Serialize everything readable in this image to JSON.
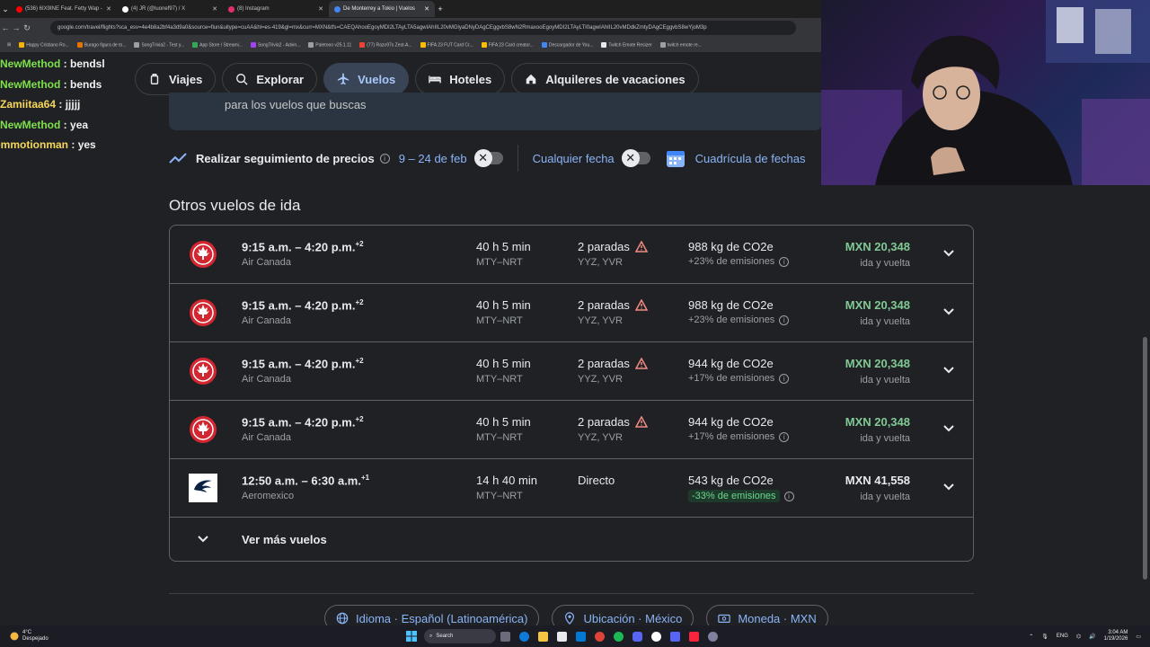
{
  "browser": {
    "tabs": [
      {
        "label": "(536) 6IX9INE Feat. Fetty Wap -",
        "color": "#ff0000"
      },
      {
        "label": "(4) JR (@luonef97) / X",
        "color": "#ffffff"
      },
      {
        "label": "(8) Instagram",
        "color": "#e1306c"
      },
      {
        "label": "De Monterrey a Tokio | Vuelos",
        "color": "#4285f4"
      }
    ],
    "url": "google.com/travel/flights?sca_esv=4e4b8a2bf4a3d9a0&source=flun&uitype=cuAA&hl=es-419&gl=mx&curr=MXN&tfs=CAEQAhooEgoyMDI2LTAyLTA5agwIAhIIL20vMGlyaDNyDAgCEggvbS8wN2RmaxooEgoyMDI2LTAyLTI0agwIAhIIL20vMDdkZmtyDAgCEggvbS8wYjoM3p",
    "bookmarks": [
      "Happy Cristiano Ro...",
      "Burago figura de to...",
      "SongTrivia2 - Test y...",
      "App Store / Streami...",
      "SongTrivia2 - Advin...",
      "Paletooo v25.1.11",
      "(77) Razo97s Zest-A...",
      "FIFA 23 FUT Card Cr...",
      "FIFA 23 Card creator...",
      "Descargador de You...",
      "Twitch Emote Resizer",
      "twitch emote re..."
    ]
  },
  "chat": [
    {
      "user": "NewMethod",
      "message": "bendsl",
      "color": "green"
    },
    {
      "user": "NewMethod",
      "message": "bends",
      "color": "green"
    },
    {
      "user": "Zamiitaa64",
      "message": "jjjjj",
      "color": "yellow"
    },
    {
      "user": "NewMethod",
      "message": "yea",
      "color": "green"
    },
    {
      "user": "emmotionman",
      "message": "yes",
      "color": "yellow"
    }
  ],
  "nav": {
    "viajes": "Viajes",
    "explorar": "Explorar",
    "vuelos": "Vuelos",
    "hoteles": "Hoteles",
    "alquileres": "Alquileres de vacaciones"
  },
  "infobox_text": "para los vuelos que buscas",
  "tracker": {
    "label": "Realizar seguimiento de precios",
    "dates": "9 – 24 de feb",
    "any_date": "Cualquier fecha",
    "grid": "Cuadrícula de fechas"
  },
  "section_title": "Otros vuelos de ida",
  "flights": [
    {
      "times": "9:15 a.m. – 4:20 p.m.",
      "plus": "+2",
      "airline": "Air Canada",
      "duration": "40 h 5 min",
      "route": "MTY–NRT",
      "stops": "2 paradas",
      "airports": "YYZ, YVR",
      "co2": "988 kg de CO2e",
      "emissions": "+23% de emisiones",
      "price": "MXN 20,348",
      "trip": "ida y vuelta"
    },
    {
      "times": "9:15 a.m. – 4:20 p.m.",
      "plus": "+2",
      "airline": "Air Canada",
      "duration": "40 h 5 min",
      "route": "MTY–NRT",
      "stops": "2 paradas",
      "airports": "YYZ, YVR",
      "co2": "988 kg de CO2e",
      "emissions": "+23% de emisiones",
      "price": "MXN 20,348",
      "trip": "ida y vuelta"
    },
    {
      "times": "9:15 a.m. – 4:20 p.m.",
      "plus": "+2",
      "airline": "Air Canada",
      "duration": "40 h 5 min",
      "route": "MTY–NRT",
      "stops": "2 paradas",
      "airports": "YYZ, YVR",
      "co2": "944 kg de CO2e",
      "emissions": "+17% de emisiones",
      "price": "MXN 20,348",
      "trip": "ida y vuelta"
    },
    {
      "times": "9:15 a.m. – 4:20 p.m.",
      "plus": "+2",
      "airline": "Air Canada",
      "duration": "40 h 5 min",
      "route": "MTY–NRT",
      "stops": "2 paradas",
      "airports": "YYZ, YVR",
      "co2": "944 kg de CO2e",
      "emissions": "+17% de emisiones",
      "price": "MXN 20,348",
      "trip": "ida y vuelta"
    },
    {
      "times": "12:50 a.m. – 6:30 a.m.",
      "plus": "+1",
      "airline": "Aeromexico",
      "duration": "14 h 40 min",
      "route": "MTY–NRT",
      "stops": "Directo",
      "airports": "",
      "co2": "543 kg de CO2e",
      "emissions": "-33% de emisiones",
      "price": "MXN 41,558",
      "trip": "ida y vuelta"
    }
  ],
  "more_flights": "Ver más vuelos",
  "footer": {
    "language": "Idioma · Español (Latinoamérica)",
    "location": "Ubicación · México",
    "currency": "Moneda · MXN"
  },
  "taskbar": {
    "weather_temp": "4°C",
    "weather_desc": "Despejado",
    "search": "Search",
    "lang": "ENG",
    "time": "3:04 AM",
    "date": "1/19/2026"
  },
  "colors": {
    "accent": "#8ab4f8",
    "price_green": "#81c995",
    "aircanada_red": "#d22630",
    "warning": "#f28b82"
  }
}
